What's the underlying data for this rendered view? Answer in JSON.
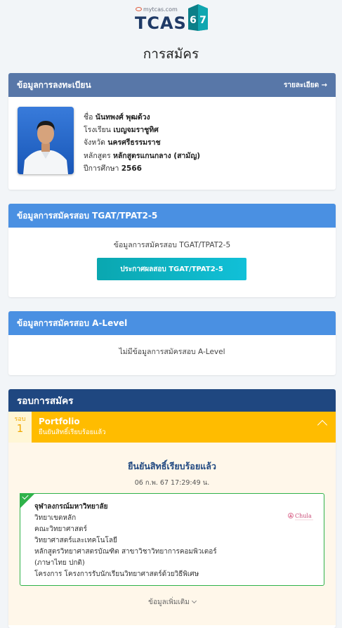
{
  "logo": {
    "site": "mytcas.com",
    "brand": "TCAS",
    "year": "67"
  },
  "page_title": "การสมัคร",
  "registration": {
    "header": "ข้อมูลการลงทะเบียน",
    "detail_link": "รายละเอียด →",
    "fields": [
      {
        "label": "ชื่อ",
        "value": "นันทพงศ์ พุฒด้วง"
      },
      {
        "label": "โรงเรียน",
        "value": "เบญจมราชูทิศ"
      },
      {
        "label": "จังหวัด",
        "value": "นครศรีธรรมราช"
      },
      {
        "label": "หลักสูตร",
        "value": "หลักสูตรแกนกลาง (สามัญ)"
      },
      {
        "label": "ปีการศึกษา",
        "value": "2566"
      }
    ]
  },
  "tgat": {
    "header": "ข้อมูลการสมัครสอบ TGAT/TPAT2-5",
    "body_text": "ข้อมูลการสมัครสอบ TGAT/TPAT2-5",
    "button": "ประกาศผลสอบ TGAT/TPAT2-5"
  },
  "alevel": {
    "header": "ข้อมูลการสมัครสอบ A-Level",
    "empty_text": "ไม่มีข้อมูลการสมัครสอบ A-Level"
  },
  "rounds": {
    "header": "รอบการสมัคร",
    "round_label": "รอบ",
    "round_number": "1",
    "round_name": "Portfolio",
    "round_status": "ยืนยันสิทธิ์เรียบร้อยแล้ว",
    "confirmed_text": "ยืนยันสิทธิ์เรียบร้อยแล้ว",
    "datetime": "06 ก.พ. 67 17:29:49 น.",
    "university": "จุฬาลงกรณ์มหาวิทยาลัย",
    "campus": "วิทยาเขตหลัก",
    "faculty": "คณะวิทยาศาสตร์",
    "field": "วิทยาศาสตร์และเทคโนโลยี",
    "program": "หลักสูตรวิทยาศาสตรบัณฑิต สาขาวิชาวิทยาการคอมพิวเตอร์",
    "program_lang": "(ภาษาไทย ปกติ)",
    "project": "โครงการ โครงการรับนักเรียนวิทยาศาสตร์ด้วยวิธีพิเศษ",
    "uni_logo_text": "Chula",
    "more_info": "ข้อมูลเพิ่มเติม"
  },
  "colors": {
    "header_slate": "#5877a8",
    "header_blue": "#4a90e2",
    "header_navy": "#1f4780",
    "round_yellow": "#ffbc00",
    "confirm_green": "#2fb24a",
    "button_teal": "#0aa7b0"
  }
}
